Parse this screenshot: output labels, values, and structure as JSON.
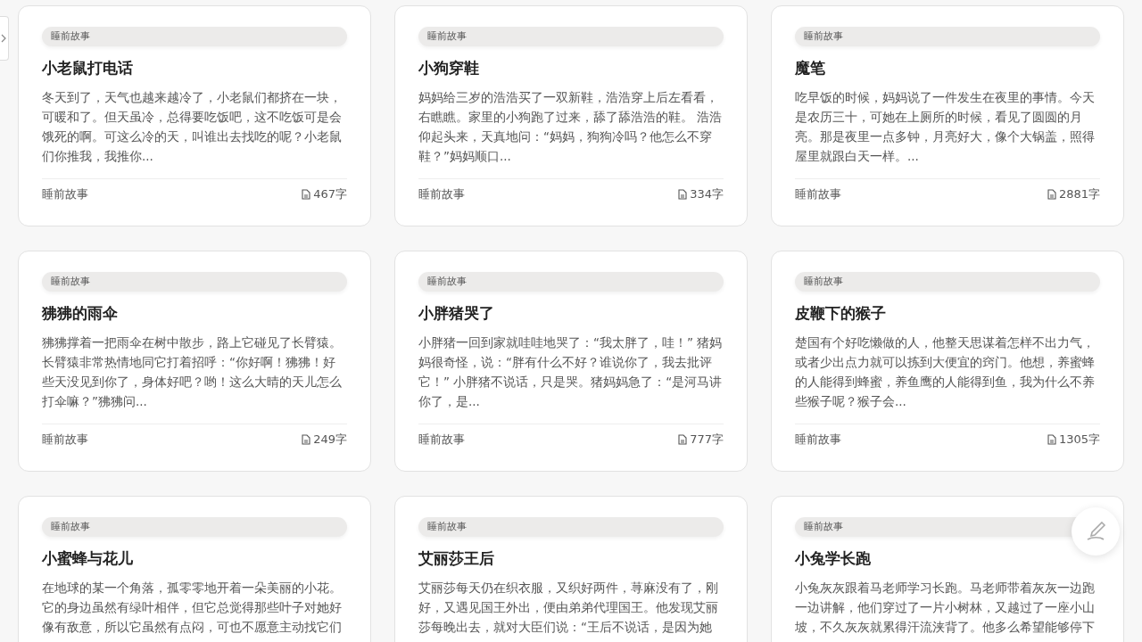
{
  "cards": [
    {
      "tag": "睡前故事",
      "title": "小老鼠打电话",
      "excerpt": "冬天到了，天气也越来越冷了，小老鼠们都挤在一块，可暖和了。但天虽冷，总得要吃饭吧，这不吃饭可是会饿死的啊。可这么冷的天，叫谁出去找吃的呢？小老鼠们你推我，我推你...",
      "category": "睡前故事",
      "word_count": "467字"
    },
    {
      "tag": "睡前故事",
      "title": "小狗穿鞋",
      "excerpt": "妈妈给三岁的浩浩买了一双新鞋，浩浩穿上后左看看，右瞧瞧。家里的小狗跑了过来，舔了舔浩浩的鞋。 浩浩仰起头来，天真地问：“妈妈，狗狗冷吗？他怎么不穿鞋？”妈妈顺口...",
      "category": "睡前故事",
      "word_count": "334字"
    },
    {
      "tag": "睡前故事",
      "title": "魔笔",
      "excerpt": "吃早饭的时候，妈妈说了一件发生在夜里的事情。今天是农历三十，可她在上厕所的时候，看见了圆圆的月亮。那是夜里一点多钟，月亮好大，像个大锅盖，照得屋里就跟白天一样。...",
      "category": "睡前故事",
      "word_count": "2881字"
    },
    {
      "tag": "睡前故事",
      "title": "狒狒的雨伞",
      "excerpt": "狒狒撑着一把雨伞在树中散步，路上它碰见了长臂猿。长臂猿非常热情地同它打着招呼：“你好啊！狒狒！好些天没见到你了，身体好吧？哟！这么大晴的天儿怎么打伞嘛？”狒狒问...",
      "category": "睡前故事",
      "word_count": "249字"
    },
    {
      "tag": "睡前故事",
      "title": "小胖猪哭了",
      "excerpt": "小胖猪一回到家就哇哇地哭了：“我太胖了，哇！” 猪妈妈很奇怪，说：“胖有什么不好？谁说你了，我去批评它！” 小胖猪不说话，只是哭。猪妈妈急了：“是河马讲你了，是...",
      "category": "睡前故事",
      "word_count": "777字"
    },
    {
      "tag": "睡前故事",
      "title": "皮鞭下的猴子",
      "excerpt": "楚国有个好吃懒做的人，他整天思谋着怎样不出力气，或者少出点力就可以拣到大便宜的窍门。他想，养蜜蜂的人能得到蜂蜜，养鱼鹰的人能得到鱼，我为什么不养些猴子呢？猴子会...",
      "category": "睡前故事",
      "word_count": "1305字"
    },
    {
      "tag": "睡前故事",
      "title": "小蜜蜂与花儿",
      "excerpt": "在地球的某一个角落，孤零零地开着一朵美丽的小花。它的身边虽然有绿叶相伴，但它总觉得那些叶子对她好像有敌意，所以它虽然有点闷，可也不愿意主动找它们"
    },
    {
      "tag": "睡前故事",
      "title": "艾丽莎王后",
      "excerpt": "艾丽莎每天仍在织衣服，又织好两件，荨麻没有了，刚好，又遇见国王外出，便由弟弟代理国王。他发现艾丽莎每晚出去，就对大臣们说：“王后不说话，是因为她"
    },
    {
      "tag": "睡前故事",
      "title": "小兔学长跑",
      "excerpt": "小兔灰灰跟着马老师学习长跑。马老师带着灰灰一边跑一边讲解，他们穿过了一片小树林，又越过了一座小山坡，不久灰灰就累得汗流浃背了。他多么希望能够停下"
    }
  ]
}
